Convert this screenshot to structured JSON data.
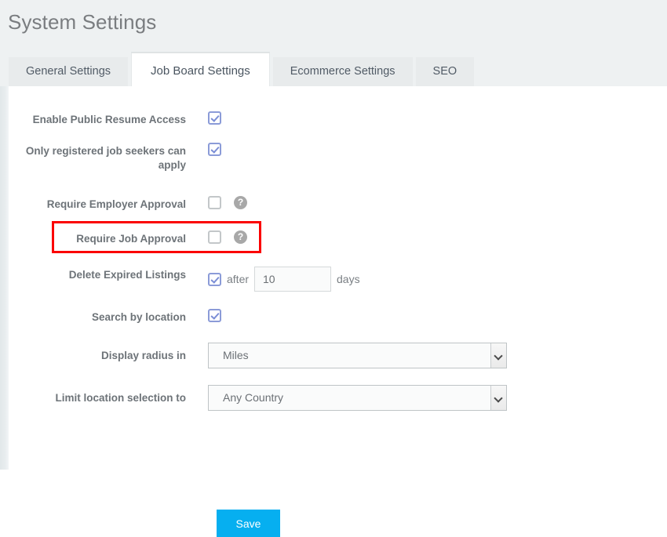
{
  "page": {
    "title": "System Settings"
  },
  "tabs": [
    {
      "label": "General Settings",
      "active": false
    },
    {
      "label": "Job Board Settings",
      "active": true
    },
    {
      "label": "Ecommerce Settings",
      "active": false
    },
    {
      "label": "SEO",
      "active": false
    }
  ],
  "form": {
    "rows": [
      {
        "label": "Enable Public Resume Access",
        "checked": true,
        "help": false
      },
      {
        "label": "Only registered job seekers can apply",
        "checked": true,
        "help": false
      },
      {
        "label": "Require Employer Approval",
        "checked": false,
        "help": true
      },
      {
        "label": "Require Job Approval",
        "checked": false,
        "help": true
      }
    ],
    "delete_expired": {
      "label": "Delete Expired Listings",
      "checked": true,
      "after_text": "after",
      "days_value": "10",
      "days_text": "days"
    },
    "search_by_location": {
      "label": "Search by location",
      "checked": true
    },
    "display_radius": {
      "label": "Display radius in",
      "value": "Miles"
    },
    "limit_location": {
      "label": "Limit location selection to",
      "value": "Any Country"
    },
    "save_label": "Save",
    "help_icon_glyph": "?"
  },
  "colors": {
    "accent": "#06aff0",
    "highlight": "#fb0000",
    "checkbox": "#8b9bd8",
    "band": "#eef1f2"
  }
}
